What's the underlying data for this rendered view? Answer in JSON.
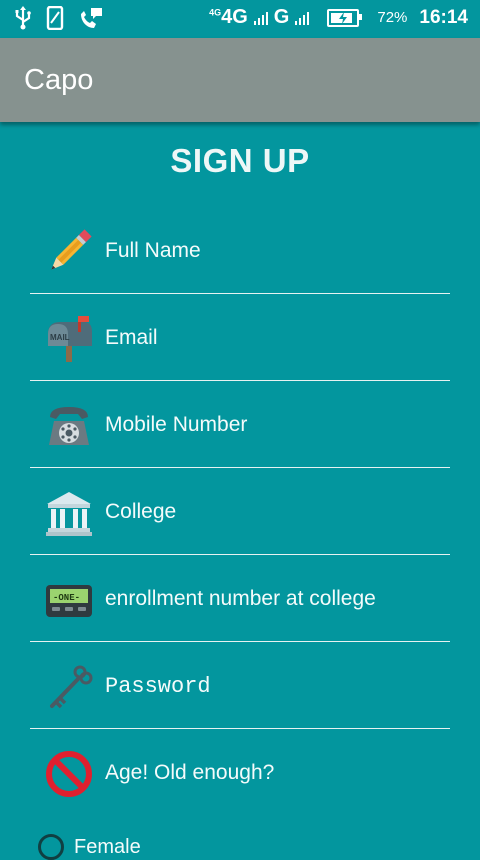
{
  "status_bar": {
    "icons_left": [
      "usb-icon",
      "phone-outline-icon",
      "call-message-icon"
    ],
    "net_prefix": "4G",
    "net_label": "4G",
    "net_label2": "G",
    "battery_level": 0.72,
    "battery_pct": "72%",
    "time": "16:14"
  },
  "app_bar": {
    "title": "Capo"
  },
  "heading": "SIGN UP",
  "fields": [
    {
      "icon": "pencil-icon",
      "label": "Full Name"
    },
    {
      "icon": "mailbox-icon",
      "label": "Email"
    },
    {
      "icon": "telephone-icon",
      "label": "Mobile Number"
    },
    {
      "icon": "classical-building-icon",
      "label": "College"
    },
    {
      "icon": "pager-icon",
      "label": "enrollment number at college"
    },
    {
      "icon": "key-icon",
      "label": "Password"
    },
    {
      "icon": "no-entry-icon",
      "label": "Age! Old enough?"
    }
  ],
  "gender": {
    "option_female": "Female"
  },
  "pager_text": "-ONE-",
  "mailbox_text": "MAIL",
  "colors": {
    "background": "#03969e",
    "app_bar": "#86928f",
    "text": "#ffffff"
  }
}
